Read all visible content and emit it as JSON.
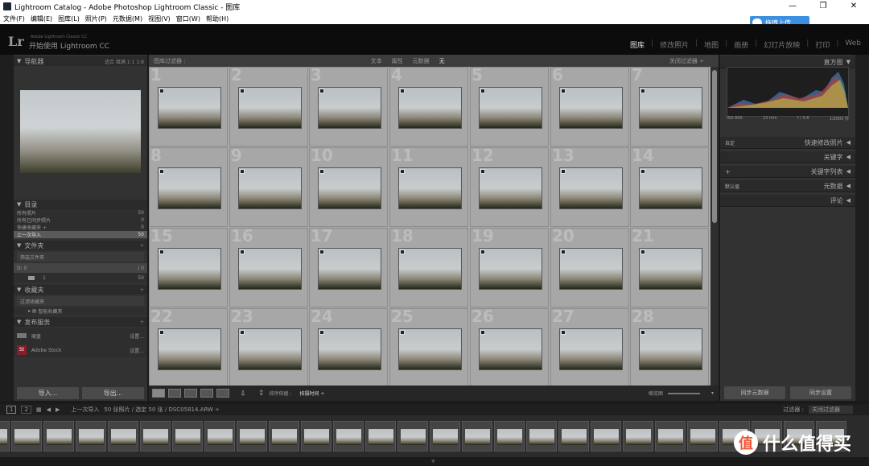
{
  "titlebar": {
    "title": "Lightroom Catalog - Adobe Photoshop Lightroom Classic - 图库",
    "min": "—",
    "max": "❐",
    "close": "✕"
  },
  "menu": [
    "文件(F)",
    "编辑(E)",
    "图库(L)",
    "照片(P)",
    "元数据(M)",
    "视图(V)",
    "窗口(W)",
    "帮助(H)"
  ],
  "upload": {
    "label": "拖拽上传"
  },
  "identity": {
    "logo": "Lr",
    "line1": "Adobe Lightroom Classic CC",
    "line2": "开始使用 Lightroom CC"
  },
  "modules": [
    "图库",
    "修改照片",
    "地图",
    "画册",
    "幻灯片放映",
    "打印",
    "Web"
  ],
  "navigator": {
    "title": "导航器",
    "options": [
      "适合",
      "填满",
      "1:1",
      "1:8"
    ]
  },
  "catalog": {
    "title": "目录",
    "items": [
      {
        "label": "所有照片",
        "count": "50"
      },
      {
        "label": "所有已同步照片",
        "count": "0"
      },
      {
        "label": "快捷收藏夹 +",
        "count": "0"
      },
      {
        "label": "上一次导入",
        "count": "50"
      }
    ]
  },
  "folders": {
    "title": "文件夹",
    "filter": "筛选文件夹",
    "volume": "D: 0",
    "volume_info": "/ 0",
    "folder": "1",
    "folder_count": "50"
  },
  "collections": {
    "title": "收藏夹",
    "filter": "过滤收藏夹",
    "smart": "智能收藏夹"
  },
  "publish": {
    "title": "发布服务",
    "items": [
      {
        "label": "硬盘",
        "action": "设置..."
      },
      {
        "label": "Adobe Stock",
        "action": "设置..."
      }
    ],
    "stock_badge": "St"
  },
  "leftbuttons": {
    "import": "导入...",
    "export": "导出..."
  },
  "filterbar": {
    "label": "图库过滤器 :",
    "options": [
      "文本",
      "属性",
      "元数据",
      "无"
    ],
    "preset": "关闭过滤器 ÷"
  },
  "grid_numbers": [
    "1",
    "2",
    "3",
    "4",
    "5",
    "6",
    "7",
    "8",
    "9",
    "10",
    "11",
    "12",
    "13",
    "14",
    "15",
    "16",
    "17",
    "18",
    "19",
    "20",
    "21",
    "22",
    "23",
    "24",
    "25",
    "26",
    "27",
    "28"
  ],
  "toolbar": {
    "sort_label": "排序依据 :",
    "sort_value": "拍摄时间 ÷",
    "thumb_label": "缩览图"
  },
  "rightpanel": {
    "histogram_title": "直方图",
    "exif": [
      "ISO 800",
      "23 mm",
      "f / 5.6",
      "1/2000 秒"
    ],
    "rows": [
      {
        "label": "快速修改照片",
        "prefix": "自定"
      },
      {
        "label": "关键字",
        "prefix": ""
      },
      {
        "label": "关键字列表",
        "prefix": "+"
      },
      {
        "label": "元数据",
        "prefix": "默认值"
      },
      {
        "label": "评论",
        "prefix": ""
      }
    ],
    "sync_meta": "同步元数据",
    "sync_settings": "同步设置"
  },
  "filmbar": {
    "pages": [
      "1",
      "2"
    ],
    "source": "上一次导入",
    "summary": "50 张照片 / 选定 50 张 / DSC05814.ARW ÷",
    "filter_label": "过滤器 :",
    "filter_value": "关闭过滤器"
  },
  "watermark": {
    "logo": "值",
    "text": "什么值得买"
  }
}
